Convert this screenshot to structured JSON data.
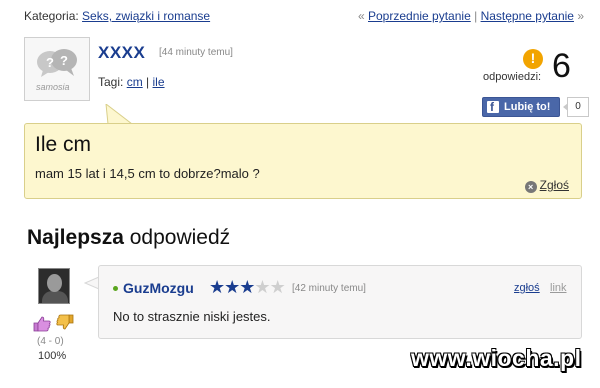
{
  "topbar": {
    "category_label": "Kategoria:",
    "category_link": "Seks, związki i romanse",
    "prev_prefix": "«",
    "prev_link": "Poprzednie pytanie",
    "separator": "|",
    "next_link": "Następne pytanie",
    "next_suffix": "»"
  },
  "question": {
    "avatar_logo_text": "samosia",
    "user": "XXXX",
    "time": "[44 minuty temu]",
    "tags_label": "Tagi:",
    "tags": [
      "cm",
      "ile"
    ],
    "tag_separator": "|",
    "answers_icon": "!",
    "answers_label": "odpowiedzi:",
    "answers_count": "6",
    "like_label": "Lubię to!",
    "like_count": "0",
    "title": "Ile cm",
    "body": "mam 15 lat i 14,5 cm to dobrze?malo ?",
    "report_label": "Zgłoś"
  },
  "best_answer": {
    "heading_bold": "Najlepsza",
    "heading_rest": "odpowiedź",
    "user": "GuzMozgu",
    "stars_filled": 3,
    "stars_total": 5,
    "time": "[42 minuty temu]",
    "report_label": "zgłoś",
    "link_label": "link",
    "text": "No to strasznie niski jestes.",
    "vote_ratio": "(4 - 0)",
    "vote_percent": "100%"
  },
  "watermark": "www.wiocha.pl",
  "colors": {
    "link": "#1a3d8f",
    "question_bg": "#fdf7cf",
    "answer_bg": "#f7f6f6",
    "facebook": "#4a67a8",
    "badge": "#f2a400"
  }
}
